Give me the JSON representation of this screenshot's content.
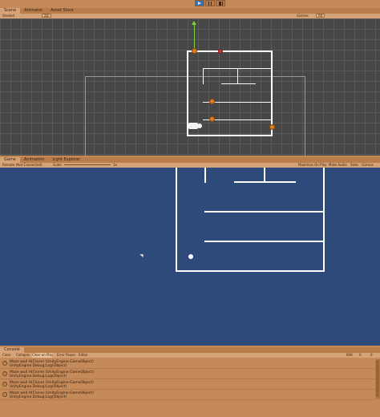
{
  "toolbar_play": {
    "play": "play-icon",
    "pause": "pause-icon",
    "step": "step-icon"
  },
  "scene_tabs": [
    {
      "label": "Scene"
    },
    {
      "label": "Animator"
    },
    {
      "label": "Asset Store"
    }
  ],
  "scene_toolbar": {
    "shading": "Shaded",
    "mode": "2D",
    "gizmos": "Gizmos",
    "search": "All"
  },
  "game_tabs": [
    {
      "label": "Game"
    },
    {
      "label": "Animation"
    },
    {
      "label": "Light Explorer"
    }
  ],
  "game_toolbar": {
    "display": "Remote (Not Connected)",
    "scale_label": "Scale",
    "scale_value": "1x",
    "maximize": "Maximize On Play",
    "mute": "Mute Audio",
    "stats": "Stats",
    "gizmos": "Gizmos"
  },
  "console": {
    "tab": "Console",
    "clear": "Clear",
    "collapse": "Collapse",
    "clear_on_play": "Clear on Play",
    "error_pause": "Error Pause",
    "editor": "Editor",
    "count": "608",
    "warn_count": "0",
    "err_count": "0",
    "entries": [
      {
        "line1": "Maze wall H(Clone) (UnityEngine.GameObject)",
        "line2": "UnityEngine.Debug:Log(Object)"
      },
      {
        "line1": "Maze wall H(Clone) (UnityEngine.GameObject)",
        "line2": "UnityEngine.Debug:Log(Object)"
      },
      {
        "line1": "Maze wall H(Clone) (UnityEngine.GameObject)",
        "line2": "UnityEngine.Debug:Log(Object)"
      },
      {
        "line1": "Maze wall H(Clone) (UnityEngine.GameObject)",
        "line2": "UnityEngine.Debug:Log(Object)"
      }
    ]
  },
  "colors": {
    "scene_bg": "#474747",
    "game_bg": "#2e4a7a",
    "editor_accent": "#c58a5a",
    "wall": "#ffffff"
  }
}
